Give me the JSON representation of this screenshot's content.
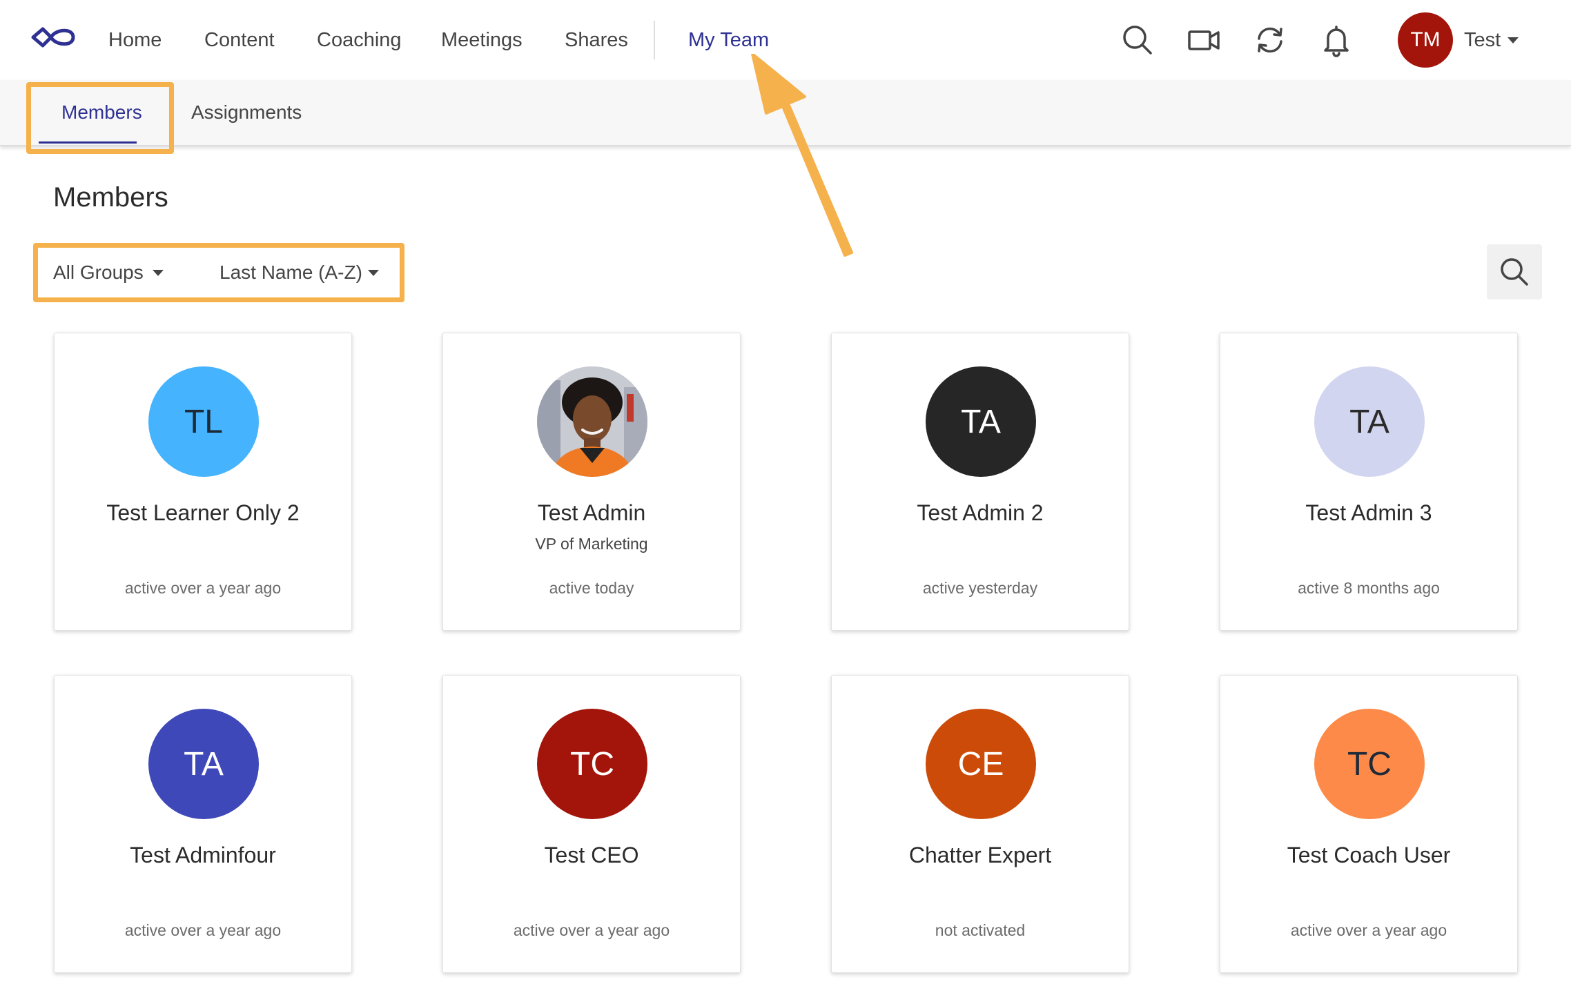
{
  "nav": {
    "items": [
      {
        "label": "Home"
      },
      {
        "label": "Content"
      },
      {
        "label": "Coaching"
      },
      {
        "label": "Meetings"
      },
      {
        "label": "Shares"
      },
      {
        "label": "My Team"
      }
    ],
    "active_item": "My Team",
    "icons": [
      "search-icon",
      "video-camera-icon",
      "sync-icon",
      "bell-icon"
    ],
    "user": {
      "initials": "TM",
      "name": "Test",
      "avatar_color": "#a3150b"
    }
  },
  "subnav": {
    "tabs": [
      {
        "label": "Members"
      },
      {
        "label": "Assignments"
      }
    ],
    "active_tab": "Members"
  },
  "page": {
    "title": "Members",
    "filters": {
      "group": "All Groups",
      "sort": "Last Name (A-Z)"
    },
    "search_icon": "search-icon"
  },
  "members": [
    {
      "initials": "TL",
      "name": "Test Learner Only 2",
      "role": "",
      "status": "active over a year ago",
      "avatar_color": "#45b3fd",
      "text_color": "#1e2a38"
    },
    {
      "initials": "",
      "name": "Test Admin",
      "role": "VP of Marketing",
      "status": "active today",
      "avatar_color": "#cfcfd4",
      "text_color": "#ffffff",
      "photo": true
    },
    {
      "initials": "TA",
      "name": "Test Admin 2",
      "role": "",
      "status": "active yesterday",
      "avatar_color": "#262626",
      "text_color": "#ffffff"
    },
    {
      "initials": "TA",
      "name": "Test Admin 3",
      "role": "",
      "status": "active 8 months ago",
      "avatar_color": "#d1d5ef",
      "text_color": "#2b2b2b"
    },
    {
      "initials": "TA",
      "name": "Test Adminfour",
      "role": "",
      "status": "active over a year ago",
      "avatar_color": "#3f48b8",
      "text_color": "#ffffff"
    },
    {
      "initials": "TC",
      "name": "Test CEO",
      "role": "",
      "status": "active over a year ago",
      "avatar_color": "#a3150b",
      "text_color": "#ffffff"
    },
    {
      "initials": "CE",
      "name": "Chatter Expert",
      "role": "",
      "status": "not activated",
      "avatar_color": "#cc4b09",
      "text_color": "#ffffff"
    },
    {
      "initials": "TC",
      "name": "Test Coach User",
      "role": "",
      "status": "active over a year ago",
      "avatar_color": "#fd8a48",
      "text_color": "#1e2a38"
    }
  ],
  "colors": {
    "accent": "#2e3192",
    "highlight": "#f5b14c"
  }
}
